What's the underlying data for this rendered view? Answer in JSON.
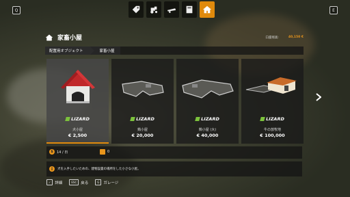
{
  "topbar": {
    "left_key": "Q",
    "right_key": "E",
    "tabs": [
      {
        "name": "tag-icon",
        "active": false
      },
      {
        "name": "tractor-icon",
        "active": false
      },
      {
        "name": "trailer-icon",
        "active": false
      },
      {
        "name": "building-icon",
        "active": false
      },
      {
        "name": "home-icon",
        "active": true
      }
    ]
  },
  "header": {
    "title": "家畜小屋",
    "money_label": "口座残高:",
    "money_value": "40,150 €"
  },
  "breadcrumb": {
    "first": "配置用オブジェクト",
    "second": "家畜小屋"
  },
  "cards": [
    {
      "brand": "LIZARD",
      "name": "犬小屋",
      "price": "€ 2,500",
      "image": "doghouse",
      "selected": true
    },
    {
      "brand": "LIZARD",
      "name": "鶏小屋",
      "price": "€ 20,000",
      "image": "pen-small",
      "selected": false
    },
    {
      "brand": "LIZARD",
      "name": "鶏小屋 (大)",
      "price": "€ 40,000",
      "image": "pen-large",
      "selected": false
    },
    {
      "brand": "LIZARD",
      "name": "牛の放牧地",
      "price": "€ 100,000",
      "image": "pasture",
      "selected": false
    }
  ],
  "info": {
    "upkeep": "14 / 日",
    "capacity": "0"
  },
  "description": "犬を入手したいための、建物設置の場所をした小さな小屋。",
  "footer": {
    "detail_key": "✓",
    "detail_label": "詳細",
    "back_key": "ESC",
    "back_label": "戻る",
    "garage_key": "G",
    "garage_label": "ガレージ"
  },
  "colors": {
    "accent": "#e08a0c",
    "brand_green": "#7cc23c"
  }
}
